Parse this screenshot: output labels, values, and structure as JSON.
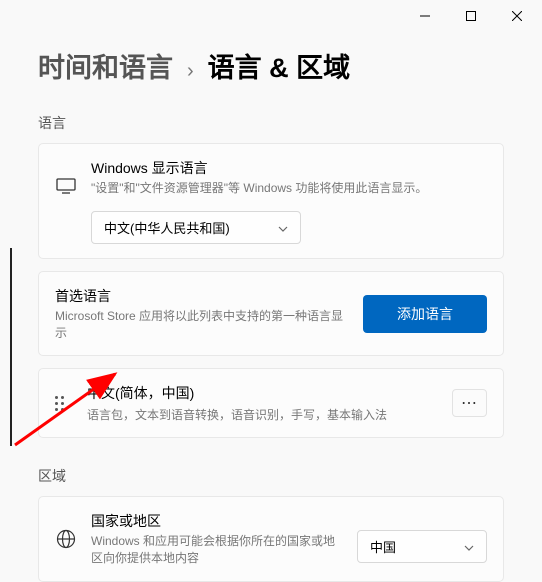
{
  "titlebar": {
    "minimize": "minimize",
    "maximize": "maximize",
    "close": "close"
  },
  "breadcrumb": {
    "parent": "时间和语言",
    "sep": "›",
    "current": "语言 & 区域"
  },
  "sections": {
    "language_label": "语言",
    "region_label": "区域"
  },
  "display_lang": {
    "title": "Windows 显示语言",
    "sub": "\"设置\"和\"文件资源管理器\"等 Windows 功能将使用此语言显示。",
    "selected": "中文(中华人民共和国)"
  },
  "preferred": {
    "title": "首选语言",
    "sub": "Microsoft Store 应用将以此列表中支持的第一种语言显示",
    "add_label": "添加语言"
  },
  "installed": {
    "name": "中文(简体，中国)",
    "features": "语言包，文本到语音转换，语音识别，手写，基本输入法"
  },
  "region": {
    "title": "国家或地区",
    "sub": "Windows 和应用可能会根据你所在的国家或地区向你提供本地内容",
    "selected": "中国"
  }
}
